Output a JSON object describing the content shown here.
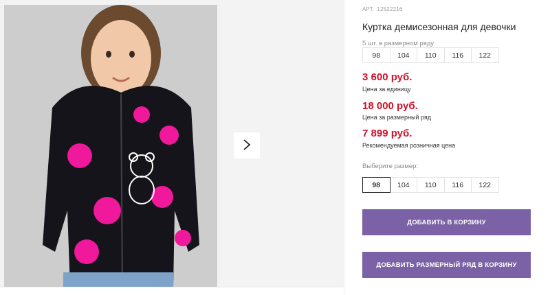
{
  "product": {
    "art_label": "АРТ.",
    "art_number": "12522216",
    "title": "Куртка демисезонная для девочки",
    "row_label": "5 шт. в размерном ряду",
    "row_sizes": [
      "98",
      "104",
      "110",
      "116",
      "122"
    ]
  },
  "prices": {
    "unit_price": "3 600 руб.",
    "unit_caption": "Цена за единицу",
    "row_price": "18 000 руб.",
    "row_caption": "Цена за размерный ряд",
    "retail_price": "7 899 руб.",
    "retail_caption": "Рекомендуемая розничная цена",
    "price_color": "#d0112b"
  },
  "size_select": {
    "label": "Выберите размер:",
    "options": [
      "98",
      "104",
      "110",
      "116",
      "122"
    ],
    "selected": "98"
  },
  "actions": {
    "add_to_cart": "Добавить в корзину",
    "add_row_to_cart": "Добавить размерный ряд в корзину",
    "button_color": "#7b61a6"
  },
  "gallery": {
    "next_icon": "chevron-right-icon",
    "photo_subject": "product-photo-girl-in-jacket"
  }
}
